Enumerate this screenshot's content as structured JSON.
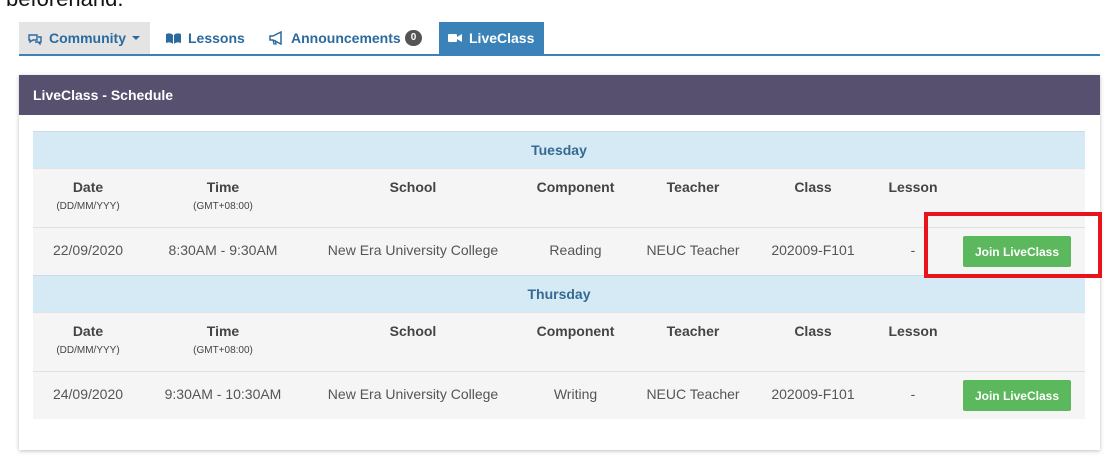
{
  "top_text": "beforehand.",
  "nav": {
    "tabs": [
      {
        "label": "Community",
        "icon": "chat-icon",
        "dropdown": true
      },
      {
        "label": "Lessons",
        "icon": "book-icon"
      },
      {
        "label": "Announcements",
        "icon": "megaphone-icon",
        "badge": "0"
      },
      {
        "label": "LiveClass",
        "icon": "video-camera-icon",
        "active": true
      }
    ]
  },
  "panel": {
    "title": "LiveClass - Schedule"
  },
  "headers": {
    "date": "Date",
    "date_sub": "(DD/MM/YYY)",
    "time": "Time",
    "time_sub": "(GMT+08:00)",
    "school": "School",
    "component": "Component",
    "teacher": "Teacher",
    "class": "Class",
    "lesson": "Lesson"
  },
  "days": [
    {
      "day": "Tuesday",
      "rows": [
        {
          "date": "22/09/2020",
          "time": "8:30AM - 9:30AM",
          "school": "New Era University College",
          "component": "Reading",
          "teacher": "NEUC Teacher",
          "class": "202009-F101",
          "lesson": "-",
          "button": "Join LiveClass"
        }
      ]
    },
    {
      "day": "Thursday",
      "rows": [
        {
          "date": "24/09/2020",
          "time": "9:30AM - 10:30AM",
          "school": "New Era University College",
          "component": "Writing",
          "teacher": "NEUC Teacher",
          "class": "202009-F101",
          "lesson": "-",
          "button": "Join LiveClass"
        }
      ]
    }
  ],
  "colors": {
    "accent": "#3b82b8",
    "panel_header": "#58506f",
    "day_bg": "#d6eaf5",
    "join_button": "#5cb85c",
    "highlight": "#e8141b"
  }
}
